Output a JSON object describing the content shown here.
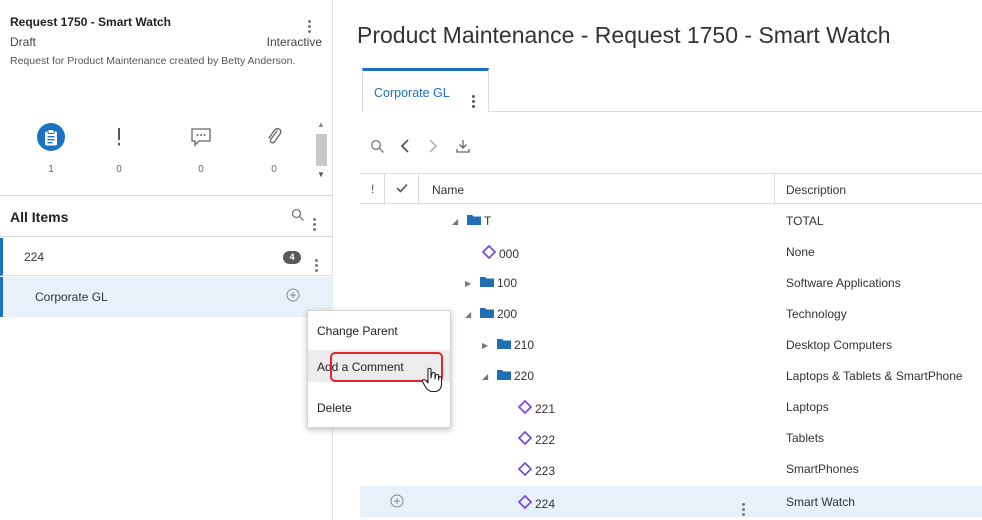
{
  "request": {
    "title": "Request 1750 - Smart Watch",
    "status": "Draft",
    "mode": "Interactive",
    "description": "Request for Product Maintenance created by Betty Anderson."
  },
  "icon_tabs": [
    {
      "icon": "clipboard-icon",
      "count": "1"
    },
    {
      "icon": "exclamation-icon",
      "count": "0"
    },
    {
      "icon": "comment-icon",
      "count": "0"
    },
    {
      "icon": "paperclip-icon",
      "count": "0"
    }
  ],
  "items_panel": {
    "heading": "All Items",
    "rows": [
      {
        "label": "224",
        "badge": "4"
      },
      {
        "label": "Corporate GL"
      }
    ]
  },
  "main": {
    "title": "Product Maintenance - Request 1750 - Smart Watch",
    "tab": "Corporate GL"
  },
  "grid": {
    "columns": {
      "flag": "!",
      "name": "Name",
      "description": "Description"
    },
    "rows": [
      {
        "name": "T",
        "description": "TOTAL"
      },
      {
        "name": "000",
        "description": "None"
      },
      {
        "name": "100",
        "description": "Software Applications"
      },
      {
        "name": "200",
        "description": "Technology"
      },
      {
        "name": "210",
        "description": "Desktop Computers"
      },
      {
        "name": "220",
        "description": "Laptops & Tablets & SmartPhone"
      },
      {
        "name": "221",
        "description": "Laptops"
      },
      {
        "name": "222",
        "description": "Tablets"
      },
      {
        "name": "223",
        "description": "SmartPhones"
      },
      {
        "name": "224",
        "description": "Smart Watch"
      }
    ]
  },
  "context_menu": {
    "items": [
      "Change Parent",
      "Add a Comment",
      "Delete"
    ],
    "highlighted": "Add a Comment"
  },
  "colors": {
    "accent": "#1b72c4",
    "selection": "#e8f1fa",
    "node_diamond": "#7b4fd6",
    "folder": "#1f6fb5",
    "focus_ring": "#e0262a"
  }
}
